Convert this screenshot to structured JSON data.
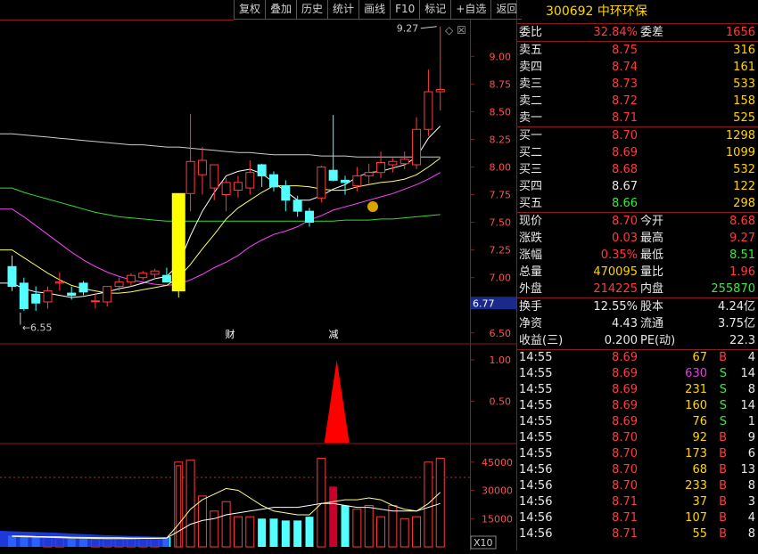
{
  "toolbar": {
    "items": [
      "复权",
      "叠加",
      "历史",
      "统计",
      "画线",
      "F10",
      "标记",
      "+自选",
      "返回"
    ],
    "diamond": "◇",
    "close": "☒"
  },
  "stock": {
    "code": "300692",
    "name": "中环环保"
  },
  "order_ratio": {
    "label1": "委比",
    "value1": "32.84%",
    "label2": "委差",
    "value2": "1656"
  },
  "asks": [
    {
      "label": "卖五",
      "price": "8.75",
      "vol": "316"
    },
    {
      "label": "卖四",
      "price": "8.74",
      "vol": "161"
    },
    {
      "label": "卖三",
      "price": "8.73",
      "vol": "533"
    },
    {
      "label": "卖二",
      "price": "8.72",
      "vol": "158"
    },
    {
      "label": "卖一",
      "price": "8.71",
      "vol": "525"
    }
  ],
  "bids": [
    {
      "label": "买一",
      "price": "8.70",
      "vol": "1298",
      "color": "red"
    },
    {
      "label": "买二",
      "price": "8.69",
      "vol": "1099",
      "color": "red"
    },
    {
      "label": "买三",
      "price": "8.68",
      "vol": "532",
      "color": "red"
    },
    {
      "label": "买四",
      "price": "8.67",
      "vol": "122",
      "color": "white"
    },
    {
      "label": "买五",
      "price": "8.66",
      "vol": "298",
      "color": "green"
    }
  ],
  "quote": [
    {
      "l1": "现价",
      "v1": "8.70",
      "c1": "red",
      "l2": "今开",
      "v2": "8.68",
      "c2": "red"
    },
    {
      "l1": "涨跌",
      "v1": "0.03",
      "c1": "red",
      "l2": "最高",
      "v2": "9.27",
      "c2": "red"
    },
    {
      "l1": "涨幅",
      "v1": "0.35%",
      "c1": "red",
      "l2": "最低",
      "v2": "8.51",
      "c2": "green"
    },
    {
      "l1": "总量",
      "v1": "470095",
      "c1": "yellow",
      "l2": "量比",
      "v2": "1.96",
      "c2": "red"
    },
    {
      "l1": "外盘",
      "v1": "214225",
      "c1": "red",
      "l2": "内盘",
      "v2": "255870",
      "c2": "green"
    }
  ],
  "stats": [
    {
      "l1": "换手",
      "v1": "12.55%",
      "l2": "股本",
      "v2": "4.24亿"
    },
    {
      "l1": "净资",
      "v1": "4.43",
      "l2": "流通",
      "v2": "3.75亿"
    },
    {
      "l1": "收益(三)",
      "v1": "0.200",
      "l2": "PE(动)",
      "v2": "22.3"
    }
  ],
  "ticks": [
    {
      "time": "14:55",
      "price": "8.69",
      "vol": "67",
      "vol_color": "yellow",
      "side": "B",
      "n": "4"
    },
    {
      "time": "14:55",
      "price": "8.69",
      "vol": "630",
      "vol_color": "magenta",
      "side": "S",
      "n": "14"
    },
    {
      "time": "14:55",
      "price": "8.69",
      "vol": "231",
      "vol_color": "yellow",
      "side": "S",
      "n": "8"
    },
    {
      "time": "14:55",
      "price": "8.69",
      "vol": "160",
      "vol_color": "yellow",
      "side": "S",
      "n": "14"
    },
    {
      "time": "14:55",
      "price": "8.69",
      "vol": "76",
      "vol_color": "yellow",
      "side": "S",
      "n": "1"
    },
    {
      "time": "14:55",
      "price": "8.70",
      "vol": "92",
      "vol_color": "yellow",
      "side": "B",
      "n": "9"
    },
    {
      "time": "14:55",
      "price": "8.70",
      "vol": "173",
      "vol_color": "yellow",
      "side": "B",
      "n": "6"
    },
    {
      "time": "14:56",
      "price": "8.70",
      "vol": "68",
      "vol_color": "yellow",
      "side": "B",
      "n": "13"
    },
    {
      "time": "14:56",
      "price": "8.70",
      "vol": "233",
      "vol_color": "yellow",
      "side": "B",
      "n": "8"
    },
    {
      "time": "14:56",
      "price": "8.71",
      "vol": "37",
      "vol_color": "yellow",
      "side": "B",
      "n": "3"
    },
    {
      "time": "14:56",
      "price": "8.71",
      "vol": "107",
      "vol_color": "yellow",
      "side": "B",
      "n": "4"
    },
    {
      "time": "14:56",
      "price": "8.71",
      "vol": "55",
      "vol_color": "yellow",
      "side": "B",
      "n": "8"
    }
  ],
  "price_axis": [
    "9.00",
    "8.75",
    "8.50",
    "8.25",
    "8.00",
    "7.75",
    "7.50",
    "7.25",
    "7.00",
    "6.75",
    "6.50"
  ],
  "price_axis_values": [
    9.0,
    8.75,
    8.5,
    8.25,
    8.0,
    7.75,
    7.5,
    7.25,
    7.0,
    6.75,
    6.5
  ],
  "current_price_tag": "6.77",
  "current_price_value": 6.77,
  "high_label": "9.27",
  "low_label": "6.55",
  "event_markers": [
    "财",
    "减"
  ],
  "indicator_axis": [
    "1.00",
    "0.50"
  ],
  "indicator_values": [
    1.0,
    0.5
  ],
  "volume_axis": [
    "45000",
    "30000",
    "15000"
  ],
  "volume_axis_values": [
    45000,
    30000,
    15000
  ],
  "volume_unit": "X10",
  "colors": {
    "up": "#ff3b3b",
    "down": "#54ffff",
    "yellow": "#ffff00",
    "ma5": "#ffffff",
    "ma10": "#ffff66",
    "ma20": "#ff44ff",
    "ma60": "#33dd33",
    "ma120": "#cccccc",
    "grid": "#8b1a1a"
  },
  "chart_data": {
    "type": "candlestick",
    "candles": [
      {
        "o": 7.1,
        "h": 7.2,
        "l": 6.88,
        "c": 6.92
      },
      {
        "o": 6.95,
        "h": 7.0,
        "l": 6.7,
        "c": 6.72
      },
      {
        "o": 6.85,
        "h": 6.92,
        "l": 6.7,
        "c": 6.77
      },
      {
        "o": 6.78,
        "h": 6.92,
        "l": 6.72,
        "c": 6.88
      },
      {
        "o": 6.95,
        "h": 7.05,
        "l": 6.88,
        "c": 6.96
      },
      {
        "o": 6.86,
        "h": 6.92,
        "l": 6.8,
        "c": 6.84
      },
      {
        "o": 6.95,
        "h": 6.97,
        "l": 6.84,
        "c": 6.87
      },
      {
        "o": 6.79,
        "h": 6.86,
        "l": 6.72,
        "c": 6.79
      },
      {
        "o": 6.78,
        "h": 6.92,
        "l": 6.74,
        "c": 6.92
      },
      {
        "o": 6.92,
        "h": 7.0,
        "l": 6.88,
        "c": 6.96
      },
      {
        "o": 6.96,
        "h": 7.04,
        "l": 6.92,
        "c": 7.02
      },
      {
        "o": 7.0,
        "h": 7.06,
        "l": 6.98,
        "c": 7.04
      },
      {
        "o": 7.03,
        "h": 7.08,
        "l": 6.98,
        "c": 7.06
      },
      {
        "o": 7.02,
        "h": 7.09,
        "l": 6.96,
        "c": 6.96
      },
      {
        "o": 6.88,
        "h": 7.68,
        "l": 6.82,
        "c": 7.76
      },
      {
        "o": 7.76,
        "h": 8.48,
        "l": 7.6,
        "c": 8.05
      },
      {
        "o": 7.93,
        "h": 8.18,
        "l": 7.75,
        "c": 8.06
      },
      {
        "o": 7.81,
        "h": 8.02,
        "l": 7.7,
        "c": 8.02
      },
      {
        "o": 7.75,
        "h": 7.9,
        "l": 7.6,
        "c": 7.86
      },
      {
        "o": 7.79,
        "h": 7.92,
        "l": 7.72,
        "c": 7.86
      },
      {
        "o": 7.81,
        "h": 8.06,
        "l": 7.75,
        "c": 7.95
      },
      {
        "o": 8.02,
        "h": 8.03,
        "l": 7.82,
        "c": 7.92
      },
      {
        "o": 7.93,
        "h": 7.96,
        "l": 7.78,
        "c": 7.82
      },
      {
        "o": 7.83,
        "h": 7.88,
        "l": 7.6,
        "c": 7.7
      },
      {
        "o": 7.7,
        "h": 7.74,
        "l": 7.55,
        "c": 7.6
      },
      {
        "o": 7.6,
        "h": 7.63,
        "l": 7.46,
        "c": 7.5
      },
      {
        "o": 7.72,
        "h": 8.01,
        "l": 7.68,
        "c": 8.0
      },
      {
        "o": 7.97,
        "h": 8.47,
        "l": 7.87,
        "c": 7.88
      },
      {
        "o": 7.88,
        "h": 7.92,
        "l": 7.75,
        "c": 7.86
      },
      {
        "o": 7.83,
        "h": 8.0,
        "l": 7.78,
        "c": 7.92
      },
      {
        "o": 7.92,
        "h": 8.03,
        "l": 7.85,
        "c": 7.95
      },
      {
        "o": 7.95,
        "h": 8.14,
        "l": 7.9,
        "c": 8.04
      },
      {
        "o": 8.02,
        "h": 8.08,
        "l": 7.95,
        "c": 8.05
      },
      {
        "o": 8.03,
        "h": 8.14,
        "l": 7.98,
        "c": 8.07
      },
      {
        "o": 8.02,
        "h": 8.45,
        "l": 7.98,
        "c": 8.34
      },
      {
        "o": 8.34,
        "h": 8.88,
        "l": 8.28,
        "c": 8.68
      },
      {
        "o": 8.68,
        "h": 9.27,
        "l": 8.51,
        "c": 8.7
      }
    ],
    "ma5": [
      6.95,
      6.9,
      6.87,
      6.86,
      6.84,
      6.82,
      6.83,
      6.85,
      6.87,
      6.9,
      6.92,
      6.95,
      6.99,
      7.01,
      7.12,
      7.38,
      7.6,
      7.77,
      7.92,
      7.96,
      7.98,
      7.94,
      7.86,
      7.78,
      7.7,
      7.7,
      7.74,
      7.8,
      7.84,
      7.91,
      7.95,
      7.96,
      7.99,
      8.02,
      8.09,
      8.26,
      8.37
    ],
    "ma10": [
      7.25,
      7.18,
      7.11,
      7.04,
      6.98,
      6.93,
      6.9,
      6.88,
      6.86,
      6.86,
      6.87,
      6.89,
      6.91,
      6.93,
      7.0,
      7.12,
      7.26,
      7.39,
      7.53,
      7.63,
      7.7,
      7.77,
      7.83,
      7.83,
      7.83,
      7.82,
      7.8,
      7.79,
      7.79,
      7.82,
      7.84,
      7.86,
      7.87,
      7.89,
      7.93,
      8.0,
      8.08
    ],
    "ma20": [
      7.62,
      7.55,
      7.47,
      7.39,
      7.31,
      7.23,
      7.16,
      7.1,
      7.05,
      7.01,
      6.98,
      6.96,
      6.94,
      6.93,
      6.94,
      6.98,
      7.03,
      7.09,
      7.14,
      7.2,
      7.28,
      7.34,
      7.39,
      7.42,
      7.46,
      7.52,
      7.56,
      7.61,
      7.64,
      7.67,
      7.7,
      7.73,
      7.76,
      7.8,
      7.84,
      7.89,
      7.95
    ],
    "ma60": [
      7.81,
      7.77,
      7.74,
      7.71,
      7.68,
      7.65,
      7.62,
      7.59,
      7.57,
      7.55,
      7.54,
      7.53,
      7.52,
      7.51,
      7.51,
      7.51,
      7.51,
      7.51,
      7.51,
      7.51,
      7.51,
      7.51,
      7.51,
      7.51,
      7.51,
      7.51,
      7.51,
      7.51,
      7.52,
      7.52,
      7.52,
      7.53,
      7.53,
      7.54,
      7.55,
      7.56,
      7.57
    ],
    "ma120": [
      8.3,
      8.29,
      8.28,
      8.27,
      8.26,
      8.25,
      8.24,
      8.23,
      8.22,
      8.21,
      8.2,
      8.2,
      8.19,
      8.18,
      8.18,
      8.17,
      8.16,
      8.15,
      8.14,
      8.13,
      8.13,
      8.12,
      8.11,
      8.11,
      8.11,
      8.11,
      8.1,
      8.1,
      8.1,
      8.09,
      8.09,
      8.09,
      8.09,
      8.09,
      8.09,
      8.09,
      8.09
    ],
    "volume": [
      6000,
      5500,
      5000,
      5000,
      4600,
      4300,
      4400,
      4000,
      4200,
      4600,
      4400,
      4500,
      4700,
      5200,
      45000,
      46000,
      27000,
      19000,
      24000,
      16000,
      16000,
      15000,
      15000,
      14000,
      14000,
      16000,
      47000,
      32000,
      22000,
      20000,
      22000,
      16000,
      22000,
      15000,
      16000,
      45000,
      47000
    ],
    "vol_ma1": [
      5600,
      5400,
      5200,
      5100,
      4900,
      4700,
      4600,
      4500,
      4400,
      4400,
      4400,
      4500,
      4500,
      4700,
      12000,
      20000,
      25000,
      28000,
      31000,
      30000,
      26000,
      22000,
      19000,
      18000,
      17000,
      17000,
      23000,
      24000,
      25000,
      25000,
      26000,
      25000,
      22000,
      20000,
      19000,
      23000,
      29000
    ],
    "vol_ma2": [
      5800,
      5700,
      5500,
      5400,
      5300,
      5100,
      5000,
      4900,
      4800,
      4800,
      4700,
      4700,
      4700,
      4700,
      8300,
      12000,
      14000,
      15000,
      17000,
      18000,
      19000,
      20000,
      21000,
      21000,
      21000,
      22000,
      23000,
      23000,
      22000,
      21000,
      21000,
      20000,
      19000,
      19000,
      19000,
      21000,
      23000
    ],
    "ylim": [
      6.45,
      9.3
    ],
    "indicator_signal_index": 27,
    "indicator_signal_value": 1.0
  }
}
